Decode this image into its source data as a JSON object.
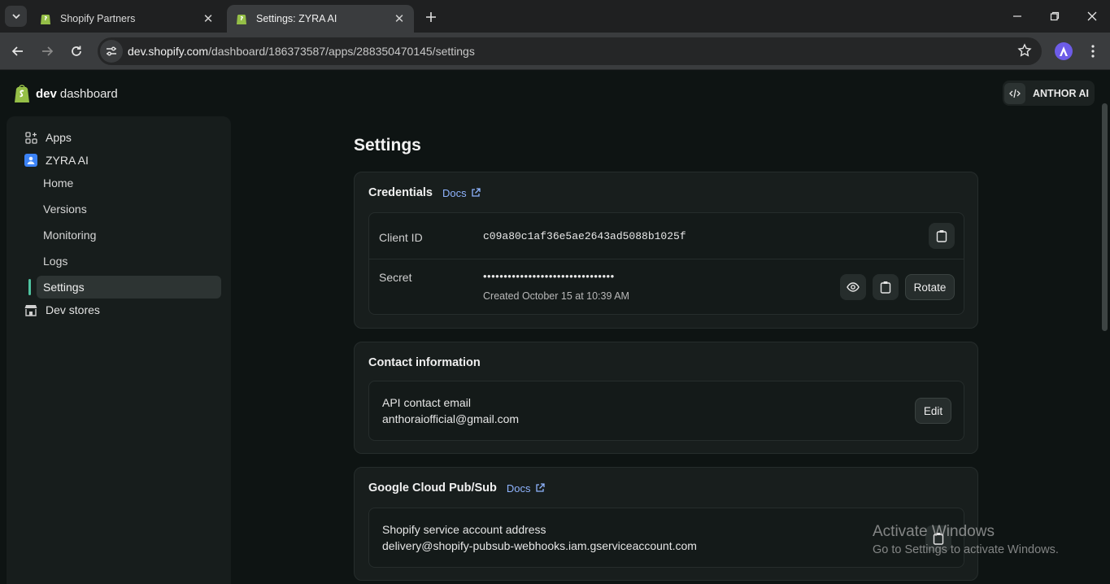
{
  "browser": {
    "tabs": [
      {
        "title": "Shopify Partners",
        "active": false
      },
      {
        "title": "Settings: ZYRA AI",
        "active": true
      }
    ],
    "url_host": "dev.shopify.com",
    "url_path": "/dashboard/186373587/apps/288350470145/settings"
  },
  "header": {
    "brand_bold": "dev",
    "brand_rest": "dashboard",
    "org_name": "ANTHOR AI"
  },
  "sidebar": {
    "apps_label": "Apps",
    "app_name": "ZYRA AI",
    "sub_items": [
      "Home",
      "Versions",
      "Monitoring",
      "Logs",
      "Settings"
    ],
    "active_sub_item": "Settings",
    "dev_stores_label": "Dev stores"
  },
  "main": {
    "title": "Settings",
    "credentials": {
      "heading": "Credentials",
      "docs_label": "Docs",
      "client_id_label": "Client ID",
      "client_id_value": "c09a80c1af36e5ae2643ad5088b1025f",
      "secret_label": "Secret",
      "secret_masked": "••••••••••••••••••••••••••••••••",
      "secret_created": "Created October 15 at 10:39 AM",
      "rotate_label": "Rotate"
    },
    "contact": {
      "heading": "Contact information",
      "email_label": "API contact email",
      "email_value": "anthoraiofficial@gmail.com",
      "edit_label": "Edit"
    },
    "pubsub": {
      "heading": "Google Cloud Pub/Sub",
      "docs_label": "Docs",
      "service_label": "Shopify service account address",
      "service_value": "delivery@shopify-pubsub-webhooks.iam.gserviceaccount.com"
    }
  },
  "watermark": {
    "line1": "Activate Windows",
    "line2": "Go to Settings to activate Windows."
  },
  "colors": {
    "accent_indicator": "#4fc3a0",
    "link": "#8fb4ff",
    "shopify_green": "#95bf47",
    "app_icon_blue": "#3b82f6"
  }
}
